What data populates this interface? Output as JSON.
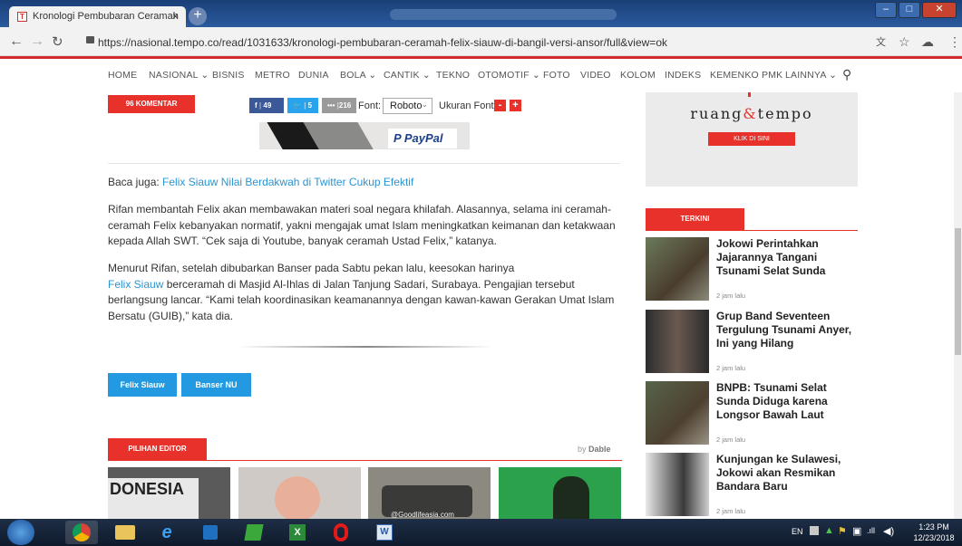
{
  "browser": {
    "tab_title": "Kronologi Pembubaran Ceramah",
    "tab_close": "×",
    "new_tab": "+",
    "url": "https://nasional.tempo.co/read/1031633/kronologi-pembubaran-ceramah-felix-siauw-di-bangil-versi-ansor/full&view=ok",
    "favicon_letter": "T"
  },
  "site_nav": {
    "items": [
      "HOME",
      "NASIONAL ⌄",
      "BISNIS",
      "METRO",
      "DUNIA",
      "BOLA ⌄",
      "CANTIK ⌄",
      "TEKNO",
      "OTOMOTIF ⌄",
      "FOTO",
      "VIDEO",
      "KOLOM",
      "INDEKS",
      "KEMENKO PMK",
      "LAINNYA ⌄"
    ]
  },
  "toolbar": {
    "comments": "96 KOMENTAR",
    "fb_count": "49",
    "tw_count": "5",
    "more_count": "216",
    "font_label": "Font:",
    "font_value": "Roboto",
    "size_label": "Ukuran Font:",
    "minus": "-",
    "plus": "+"
  },
  "ad": {
    "paypal": "PayPal"
  },
  "article": {
    "baca_prefix": "Baca juga: ",
    "baca_link": "Felix Siauw Nilai Berdakwah di Twitter Cukup Efektif",
    "para1": "Rifan membantah Felix akan membawakan materi soal negara khilafah. Alasannya, selama ini ceramah-ceramah Felix kebanyakan normatif, yakni mengajak umat Islam meningkatkan keimanan dan ketakwaan kepada Allah SWT. “Cek saja di Youtube, banyak ceramah Ustad Felix,” katanya.",
    "para2_before": "Menurut Rifan, setelah dibubarkan Banser pada Sabtu pekan lalu, keesokan harinya",
    "para2_link": "Felix Siauw",
    "para2_after": " berceramah di Masjid Al-Ihlas di Jalan Tanjung Sadari, Surabaya. Pengajian tersebut berlangsung lancar. “Kami telah koordinasikan keamanannya dengan kawan-kawan Gerakan Umat Islam Bersatu (GUIB),” kata dia.",
    "tags": [
      "Felix Siauw",
      "Banser NU"
    ]
  },
  "editor": {
    "label": "PILIHAN EDITOR",
    "by": "by",
    "dable": "Dable",
    "thumb1_text": "DONESIA",
    "thumb3_text": "@Goodlifeasia.com"
  },
  "sidebar": {
    "ruang_text_a": "ruang",
    "ruang_amp": "&",
    "ruang_text_b": "tempo",
    "ruang_btn": "KLIK DI SINI",
    "terkini": "TERKINI",
    "items": [
      {
        "title": "Jokowi Perintahkan Jajarannya Tangani Tsunami Selat Sunda",
        "time": "2 jam lalu"
      },
      {
        "title": "Grup Band Seventeen Tergulung Tsunami Anyer, Ini yang Hilang",
        "time": "2 jam lalu"
      },
      {
        "title": "BNPB: Tsunami Selat Sunda Diduga karena Longsor Bawah Laut",
        "time": "2 jam lalu"
      },
      {
        "title": "Kunjungan ke Sulawesi, Jokowi akan Resmikan Bandara Baru",
        "time": "2 jam lalu"
      }
    ]
  },
  "taskbar": {
    "lang": "EN",
    "time": "1:23 PM",
    "date": "12/23/2018"
  },
  "colors": {
    "accent": "#e8312a",
    "link": "#2a94d0",
    "tag": "#2299e0"
  }
}
